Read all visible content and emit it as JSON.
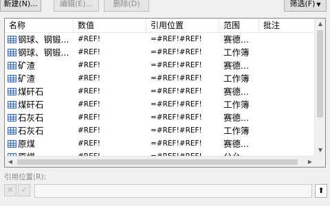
{
  "toolbar": {
    "new_label": "新建(N)...",
    "edit_label": "编辑(E)...",
    "delete_label": "删除(D)",
    "filter_label": "筛选(F)"
  },
  "table": {
    "headers": [
      "名称",
      "数值",
      "引用位置",
      "范围",
      "批注"
    ],
    "rows": [
      {
        "name": "钢球、钢锻...",
        "value": "#REF!",
        "ref": "=#REF!#REF!",
        "scope": "赛德..."
      },
      {
        "name": "钢球、钢锻...",
        "value": "#REF!",
        "ref": "=#REF!#REF!",
        "scope": "工作簿"
      },
      {
        "name": "矿渣",
        "value": "#REF!",
        "ref": "=#REF!#REF!",
        "scope": "赛德..."
      },
      {
        "name": "矿渣",
        "value": "#REF!",
        "ref": "=#REF!#REF!",
        "scope": "工作簿"
      },
      {
        "name": "煤矸石",
        "value": "#REF!",
        "ref": "=#REF!#REF!",
        "scope": "赛德..."
      },
      {
        "name": "煤矸石",
        "value": "#REF!",
        "ref": "=#REF!#REF!",
        "scope": "工作簿"
      },
      {
        "name": "石灰石",
        "value": "#REF!",
        "ref": "=#REF!#REF!",
        "scope": "赛德..."
      },
      {
        "name": "石灰石",
        "value": "#REF!",
        "ref": "=#REF!#REF!",
        "scope": "工作簿"
      },
      {
        "name": "原煤",
        "value": "#REF!",
        "ref": "=#REF!#REF!",
        "scope": "赛德..."
      },
      {
        "name": "原煤",
        "value": "#REF!",
        "ref": "=#REF!#REF!",
        "scope": "公允..."
      }
    ]
  },
  "reference": {
    "label": "引用位置(R):",
    "value": ""
  },
  "icons": {
    "row_icon": "table-icon",
    "cancel": "cancel-icon",
    "confirm": "check-icon",
    "collapse": "collapse-dialog-icon"
  }
}
